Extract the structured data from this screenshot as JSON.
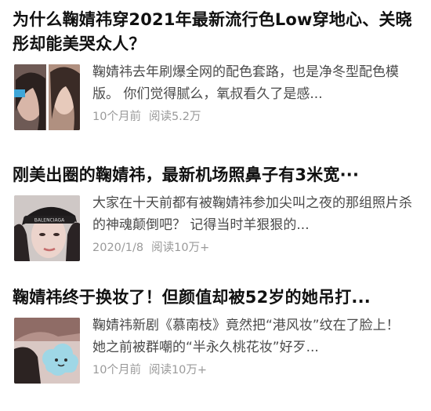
{
  "articles": [
    {
      "title": "为什么鞠婧祎穿2021年最新流行色Low穿地心、关晓彤却能美哭众人？",
      "summary": "鞠婧祎去年刷爆全网的配色套路，也是净冬型配色模版。 你们觉得腻么，氧叔看久了是感...",
      "date": "10个月前",
      "reads": "阅读5.2万",
      "thumbnail_icon": "collage-portrait-thumbnail"
    },
    {
      "title": "刚美出圈的鞠婧祎，最新机场照鼻子有3米宽···",
      "summary": "大家在十天前都有被鞠婧祎参加尖叫之夜的那组照片杀的神魂颠倒吧？ 记得当时羊狠狠的...",
      "date": "2020/1/8",
      "reads": "阅读10万+",
      "thumbnail_icon": "cap-portrait-thumbnail",
      "cap_text": "BALENCIAGA"
    },
    {
      "title": "鞠婧祎终于换妆了！但颜值却被52岁的她吊打...",
      "summary": "鞠婧祎新剧《慕南枝》竟然把“港风妆”纹在了脸上！ 她之前被群嘲的“半永久桃花妆”好歹...",
      "date": "10个月前",
      "reads": "阅读10万+",
      "thumbnail_icon": "cloud-pillow-thumbnail"
    }
  ]
}
